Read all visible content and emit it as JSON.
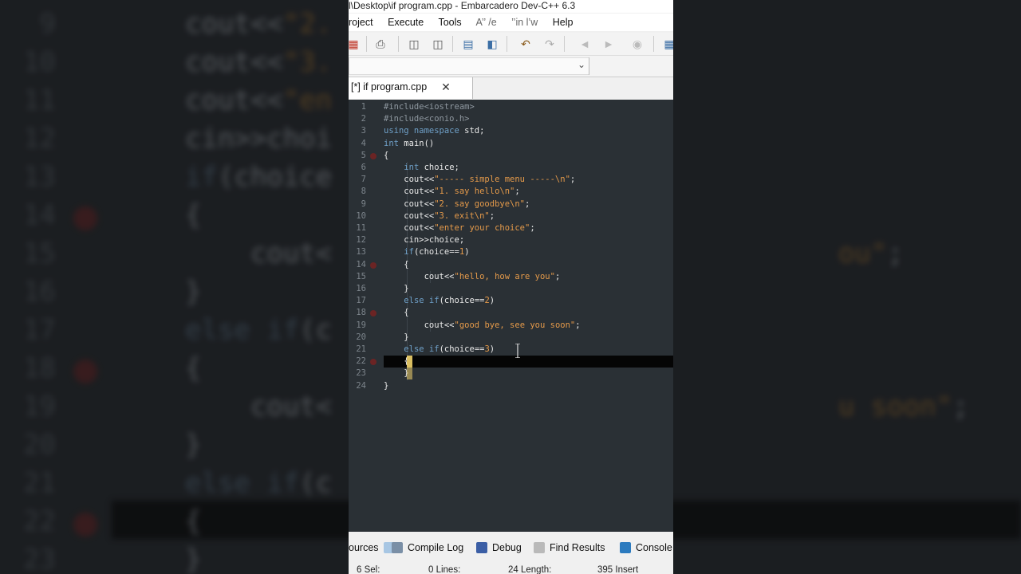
{
  "window": {
    "title": "l\\Desktop\\if program.cpp - Embarcadero Dev-C++ 6.3"
  },
  "menu": [
    "roject",
    "Execute",
    "Tools",
    "A’’ /e",
    "’’in l’w",
    "Help"
  ],
  "tab": {
    "label": "[*] if program.cpp",
    "close": "✕"
  },
  "editor": {
    "line_numbers": [
      "1",
      "2",
      "3",
      "4",
      "5",
      "6",
      "7",
      "8",
      "9",
      "10",
      "11",
      "12",
      "13",
      "14",
      "15",
      "16",
      "17",
      "18",
      "19",
      "20",
      "21",
      "22",
      "23",
      "24"
    ],
    "lines": [
      [
        {
          "t": "pp",
          "v": "#include<iostream>"
        }
      ],
      [
        {
          "t": "pp",
          "v": "#include<conio.h>"
        }
      ],
      [
        {
          "t": "kw",
          "v": "using namespace "
        },
        {
          "t": "id",
          "v": "std;"
        }
      ],
      [
        {
          "t": "kw",
          "v": "int "
        },
        {
          "t": "id",
          "v": "main()"
        }
      ],
      [
        {
          "t": "id",
          "v": "{"
        }
      ],
      [
        {
          "t": "id",
          "v": "    "
        },
        {
          "t": "kw",
          "v": "int "
        },
        {
          "t": "id",
          "v": "choice;"
        }
      ],
      [
        {
          "t": "id",
          "v": "    cout<<"
        },
        {
          "t": "str",
          "v": "\"----- simple menu -----\\n\""
        },
        {
          "t": "id",
          "v": ";"
        }
      ],
      [
        {
          "t": "id",
          "v": "    cout<<"
        },
        {
          "t": "str",
          "v": "\"1. say hello\\n\""
        },
        {
          "t": "id",
          "v": ";"
        }
      ],
      [
        {
          "t": "id",
          "v": "    cout<<"
        },
        {
          "t": "str",
          "v": "\"2. say goodbye\\n\""
        },
        {
          "t": "id",
          "v": ";"
        }
      ],
      [
        {
          "t": "id",
          "v": "    cout<<"
        },
        {
          "t": "str",
          "v": "\"3. exit\\n\""
        },
        {
          "t": "id",
          "v": ";"
        }
      ],
      [
        {
          "t": "id",
          "v": "    cout<<"
        },
        {
          "t": "str",
          "v": "\"enter your choice\""
        },
        {
          "t": "id",
          "v": ";"
        }
      ],
      [
        {
          "t": "id",
          "v": "    cin>>choice;"
        }
      ],
      [
        {
          "t": "id",
          "v": "    "
        },
        {
          "t": "kw",
          "v": "if"
        },
        {
          "t": "id",
          "v": "(choice=="
        },
        {
          "t": "num",
          "v": "1"
        },
        {
          "t": "id",
          "v": ")"
        }
      ],
      [
        {
          "t": "id",
          "v": "    {"
        }
      ],
      [
        {
          "t": "id",
          "v": "        cout<<"
        },
        {
          "t": "str",
          "v": "\"hello, how are you\""
        },
        {
          "t": "id",
          "v": ";"
        }
      ],
      [
        {
          "t": "id",
          "v": "    }"
        }
      ],
      [
        {
          "t": "id",
          "v": "    "
        },
        {
          "t": "kw",
          "v": "else if"
        },
        {
          "t": "id",
          "v": "(choice=="
        },
        {
          "t": "num",
          "v": "2"
        },
        {
          "t": "id",
          "v": ")"
        }
      ],
      [
        {
          "t": "id",
          "v": "    {"
        }
      ],
      [
        {
          "t": "id",
          "v": "        cout<<"
        },
        {
          "t": "str",
          "v": "\"good bye, see you soon\""
        },
        {
          "t": "id",
          "v": ";"
        }
      ],
      [
        {
          "t": "id",
          "v": "    }"
        }
      ],
      [
        {
          "t": "id",
          "v": "    "
        },
        {
          "t": "kw",
          "v": "else if"
        },
        {
          "t": "id",
          "v": "(choice=="
        },
        {
          "t": "num",
          "v": "3"
        },
        {
          "t": "id",
          "v": ")"
        }
      ],
      [
        {
          "t": "id",
          "v": "    {"
        }
      ],
      [
        {
          "t": "id",
          "v": "    }"
        }
      ],
      [
        {
          "t": "id",
          "v": "}"
        }
      ]
    ],
    "breakpoint_lines": [
      5,
      14,
      18,
      22
    ]
  },
  "bottom_tabs": [
    "ources",
    "Compile Log",
    "Debug",
    "Find Results",
    "Console"
  ],
  "status": {
    "sel": "6 Sel:",
    "lines": "0 Lines:",
    "length": "24 Length:",
    "mode": "395 Insert"
  },
  "background": {
    "line_numbers": [
      "9",
      "10",
      "11",
      "12",
      "13",
      "14",
      "15",
      "16",
      "17",
      "18",
      "19",
      "20",
      "21",
      "22",
      "23"
    ],
    "fragments": [
      [
        {
          "t": "id",
          "v": "cout<<"
        },
        {
          "t": "str",
          "v": "\"2."
        }
      ],
      [
        {
          "t": "id",
          "v": "cout<<"
        },
        {
          "t": "str",
          "v": "\"3."
        }
      ],
      [
        {
          "t": "id",
          "v": "cout<<"
        },
        {
          "t": "str",
          "v": "\"en"
        }
      ],
      [
        {
          "t": "id",
          "v": "cin>>choi"
        }
      ],
      [
        {
          "t": "kw",
          "v": "if"
        },
        {
          "t": "id",
          "v": "(choice"
        }
      ],
      [
        {
          "t": "id",
          "v": "{"
        }
      ],
      [
        {
          "t": "id",
          "v": "    cout<"
        },
        {
          "t": "pad",
          "v": "                               "
        },
        {
          "t": "str",
          "v": "ou\""
        },
        {
          "t": "id",
          "v": ";"
        }
      ],
      [
        {
          "t": "id",
          "v": "}"
        }
      ],
      [
        {
          "t": "kw",
          "v": "else if"
        },
        {
          "t": "id",
          "v": "(c"
        }
      ],
      [
        {
          "t": "id",
          "v": "{"
        }
      ],
      [
        {
          "t": "id",
          "v": "    cout<"
        },
        {
          "t": "pad",
          "v": "                               "
        },
        {
          "t": "str",
          "v": "u soon\""
        },
        {
          "t": "id",
          "v": ";"
        }
      ],
      [
        {
          "t": "id",
          "v": "}"
        }
      ],
      [
        {
          "t": "kw",
          "v": "else if"
        },
        {
          "t": "id",
          "v": "(c"
        }
      ],
      [
        {
          "t": "id",
          "v": "{"
        }
      ],
      [
        {
          "t": "id",
          "v": "}"
        }
      ]
    ]
  }
}
